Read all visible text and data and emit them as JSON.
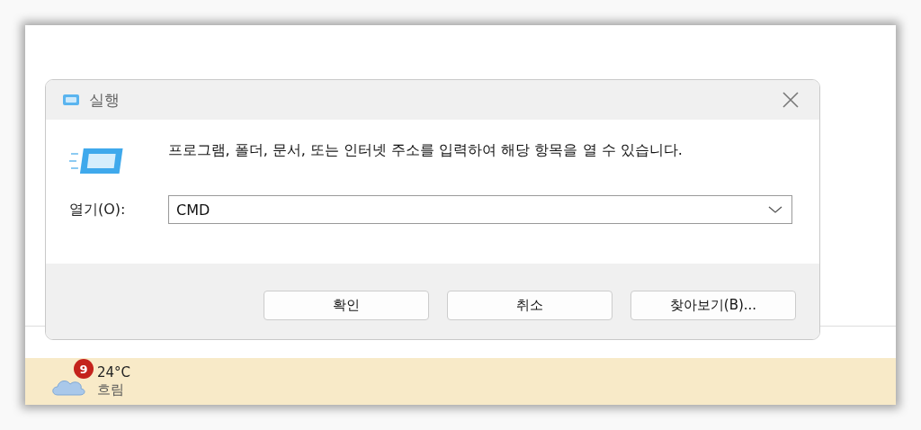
{
  "dialog": {
    "title": "실행",
    "description": "프로그램, 폴더, 문서, 또는 인터넷 주소를 입력하여 해당 항목을 열 수 있습니다.",
    "open_label": "열기(O):",
    "open_value": "CMD",
    "buttons": [
      {
        "label": "확인"
      },
      {
        "label": "취소"
      },
      {
        "label": "찾아보기(B)..."
      }
    ]
  },
  "taskbar": {
    "weather": {
      "temperature": "24°C",
      "condition": "흐림",
      "badge": "9"
    }
  }
}
